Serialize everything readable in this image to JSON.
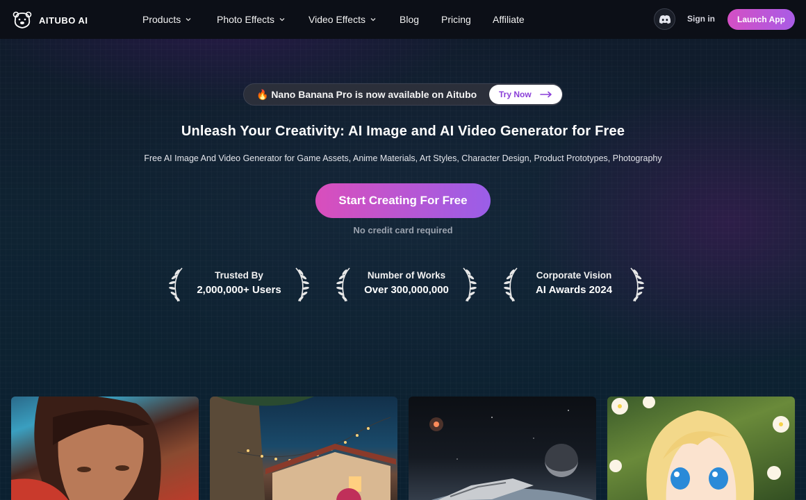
{
  "brand": {
    "name": "AITUBO AI",
    "logo_icon": "bear-icon"
  },
  "nav": {
    "items": [
      {
        "label": "Products",
        "dropdown": true
      },
      {
        "label": "Photo Effects",
        "dropdown": true
      },
      {
        "label": "Video Effects",
        "dropdown": true
      },
      {
        "label": "Blog",
        "dropdown": false
      },
      {
        "label": "Pricing",
        "dropdown": false
      },
      {
        "label": "Affiliate",
        "dropdown": false
      }
    ],
    "discord_icon": "discord-icon",
    "signin_label": "Sign in",
    "launch_label": "Launch App"
  },
  "announcement": {
    "text": "🔥 Nano Banana Pro is now available on Aitubo",
    "button_label": "Try Now"
  },
  "hero": {
    "headline": "Unleash Your Creativity: AI Image and AI Video Generator for Free",
    "subline": "Free AI Image And Video Generator for Game Assets, Anime Materials, Art Styles, Character Design, Product Prototypes, Photography",
    "cta_label": "Start Creating For Free",
    "note": "No credit card required"
  },
  "awards": [
    {
      "top": "Trusted By",
      "bottom": "2,000,000+ Users"
    },
    {
      "top": "Number of Works",
      "bottom": "Over 300,000,000"
    },
    {
      "top": "Corporate Vision",
      "bottom": "AI Awards 2024"
    }
  ],
  "gallery": [
    {
      "subject": "warrior-portrait"
    },
    {
      "subject": "village-night-lights"
    },
    {
      "subject": "spaceship-planet"
    },
    {
      "subject": "anime-girl-flowers"
    }
  ],
  "colors": {
    "accent_pink": "#d94ebc",
    "accent_purple": "#9a5ee8",
    "nav_bg": "#0c0f17",
    "page_bg": "#0f2332"
  }
}
